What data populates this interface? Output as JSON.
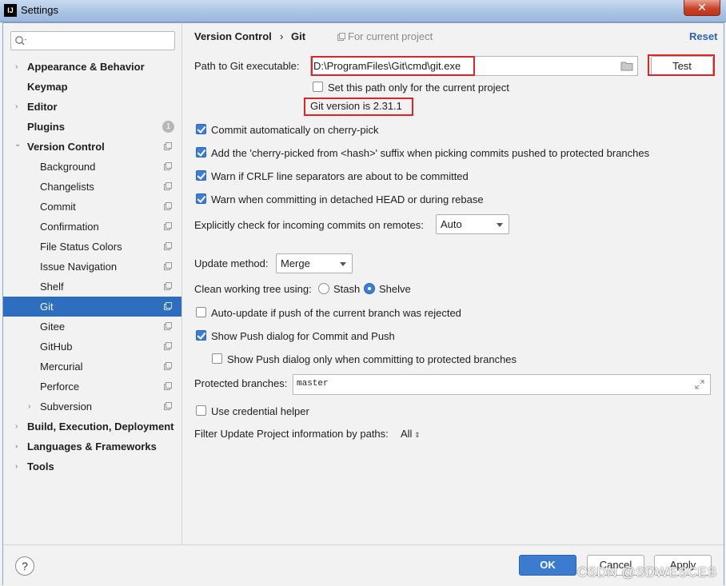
{
  "window": {
    "title": "Settings",
    "app_icon": "IJ",
    "close": "✕"
  },
  "sidebar": {
    "search_placeholder": "",
    "items": [
      {
        "label": "Appearance & Behavior",
        "arrow": "›"
      },
      {
        "label": "Keymap"
      },
      {
        "label": "Editor",
        "arrow": "›"
      },
      {
        "label": "Plugins",
        "badge": "1"
      },
      {
        "label": "Version Control",
        "arrow": "⌄"
      },
      {
        "label": "Background"
      },
      {
        "label": "Changelists"
      },
      {
        "label": "Commit"
      },
      {
        "label": "Confirmation"
      },
      {
        "label": "File Status Colors"
      },
      {
        "label": "Issue Navigation"
      },
      {
        "label": "Shelf"
      },
      {
        "label": "Git"
      },
      {
        "label": "Gitee"
      },
      {
        "label": "GitHub"
      },
      {
        "label": "Mercurial"
      },
      {
        "label": "Perforce"
      },
      {
        "label": "Subversion",
        "arrow": "›"
      },
      {
        "label": "Build, Execution, Deployment",
        "arrow": "›"
      },
      {
        "label": "Languages & Frameworks",
        "arrow": "›"
      },
      {
        "label": "Tools",
        "arrow": "›"
      }
    ]
  },
  "header": {
    "crumb1": "Version Control",
    "sep": "›",
    "crumb2": "Git",
    "scope": "For current project",
    "reset": "Reset"
  },
  "git": {
    "path_label": "Path to Git executable:",
    "path_value": "D:\\ProgramFiles\\Git\\cmd\\git.exe",
    "test_button": "Test",
    "path_only_project": "Set this path only for the current project",
    "version_text": "Git version is 2.31.1",
    "commit_cherry": "Commit automatically on cherry-pick",
    "cherry_suffix": "Add the 'cherry-picked from <hash>' suffix when picking commits pushed to protected branches",
    "warn_crlf": "Warn if CRLF line separators are about to be committed",
    "warn_detached": "Warn when committing in detached HEAD or during rebase",
    "incoming_label": "Explicitly check for incoming commits on remotes:",
    "incoming_value": "Auto",
    "update_method_label": "Update method:",
    "update_method_value": "Merge",
    "clean_tree_label": "Clean working tree using:",
    "stash": "Stash",
    "shelve": "Shelve",
    "auto_update": "Auto-update if push of the current branch was rejected",
    "show_push": "Show Push dialog for Commit and Push",
    "show_push_protected": "Show Push dialog only when committing to protected branches",
    "protected_label": "Protected branches:",
    "protected_value": "master",
    "credential_helper": "Use credential helper",
    "filter_label": "Filter Update Project information by paths:",
    "filter_value": "All"
  },
  "footer": {
    "help": "?",
    "ok": "OK",
    "cancel": "Cancel",
    "apply": "Apply"
  },
  "watermark": "CSDN @SDWESCES",
  "colors": {
    "accent": "#2d6fbe",
    "highlight": "#d9262b",
    "link": "#2a64b0"
  }
}
